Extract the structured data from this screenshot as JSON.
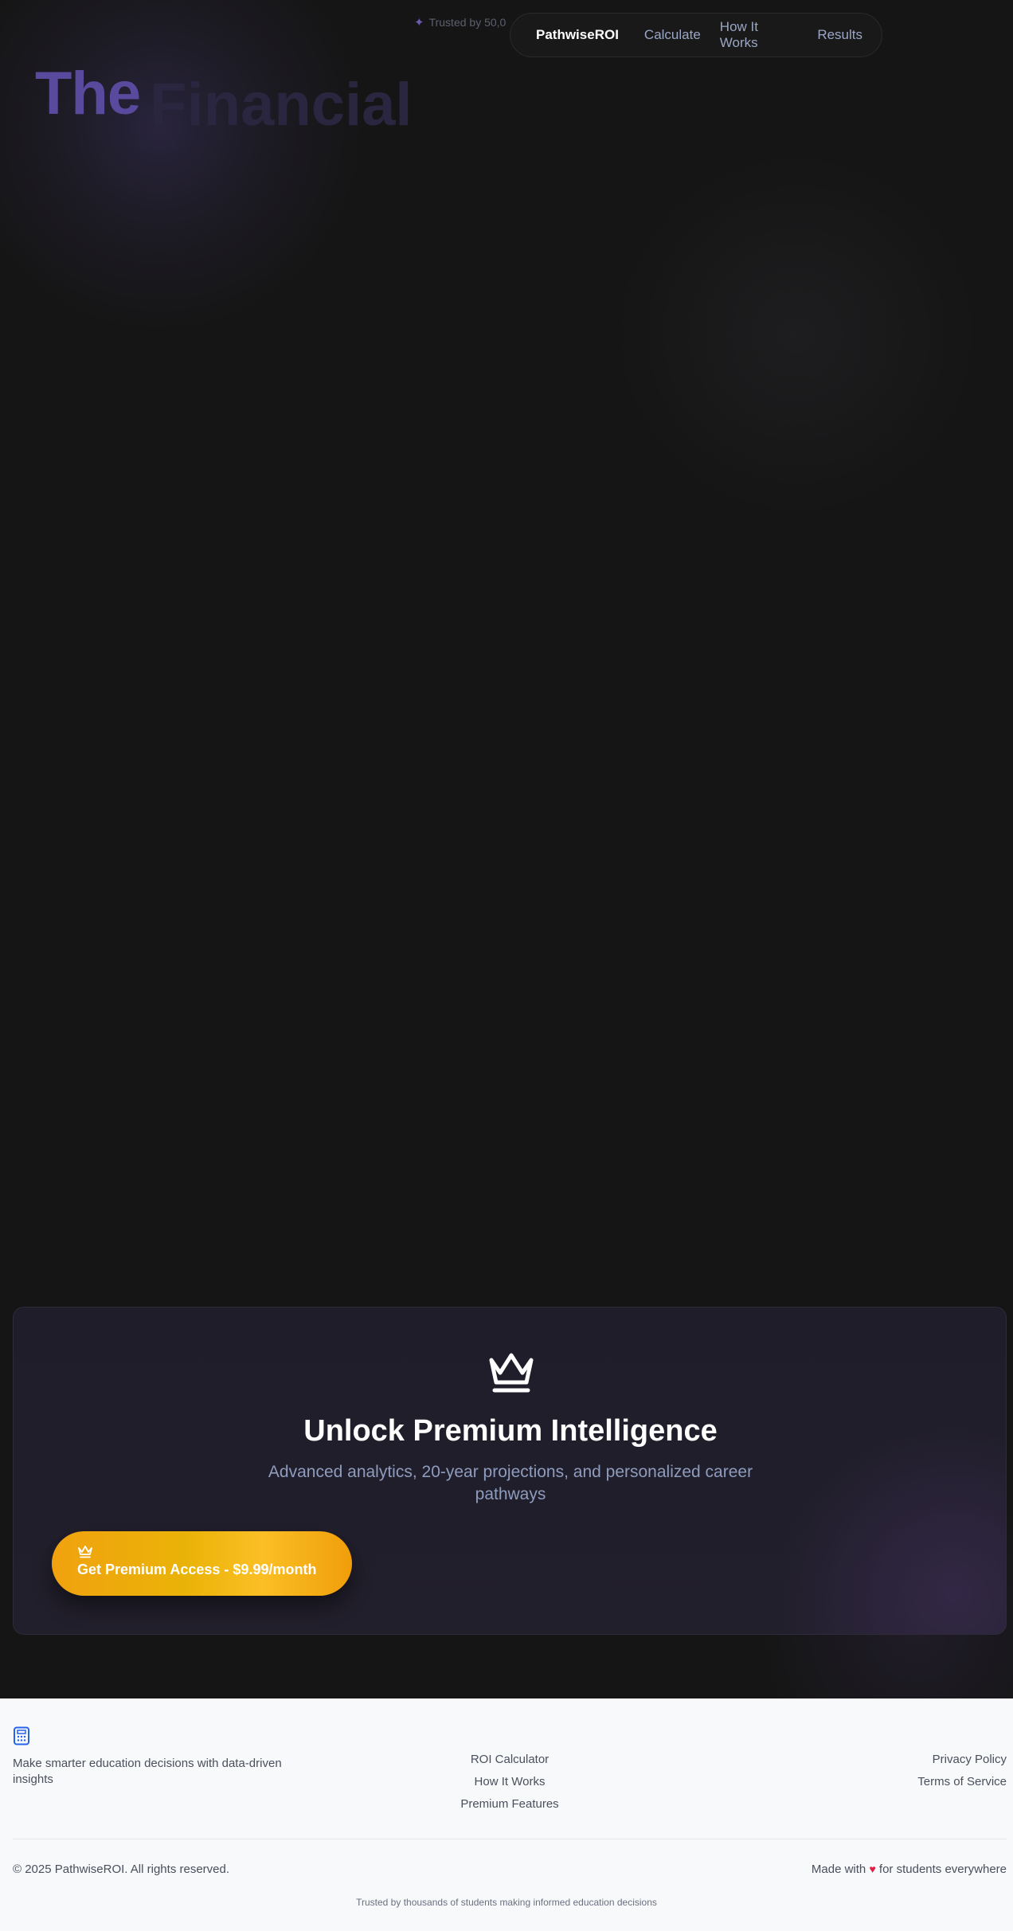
{
  "header": {
    "trusted_text": "Trusted by 50,0",
    "brand": "PathwiseROI",
    "nav": [
      {
        "label": "Calculate"
      },
      {
        "label": "How It Works"
      },
      {
        "label": "Results"
      }
    ]
  },
  "hero": {
    "title_word1": "The",
    "title_word2": "Financial"
  },
  "premium": {
    "title": "Unlock Premium Intelligence",
    "subtitle": "Advanced analytics, 20-year projections, and personalized career pathways",
    "cta_label": "Get Premium Access - $9.99/month",
    "icon": "crown-icon"
  },
  "footer": {
    "tagline": "Make smarter education decisions with data-driven insights",
    "links": [
      {
        "label": "ROI Calculator"
      },
      {
        "label": "How It Works"
      },
      {
        "label": "Premium Features"
      }
    ],
    "legal": [
      {
        "label": "Privacy Policy"
      },
      {
        "label": "Terms of Service"
      }
    ],
    "copyright": "© 2025 PathwiseROI. All rights reserved.",
    "made_with_prefix": "Made with",
    "made_with_suffix": "for students everywhere",
    "trusted": "Trusted by thousands of students making informed education decisions"
  },
  "colors": {
    "accent_purple": "#5a4a9e",
    "cta_gold": "#eab308",
    "heart_red": "#e11d48",
    "footer_bg": "#f8f9fb"
  }
}
